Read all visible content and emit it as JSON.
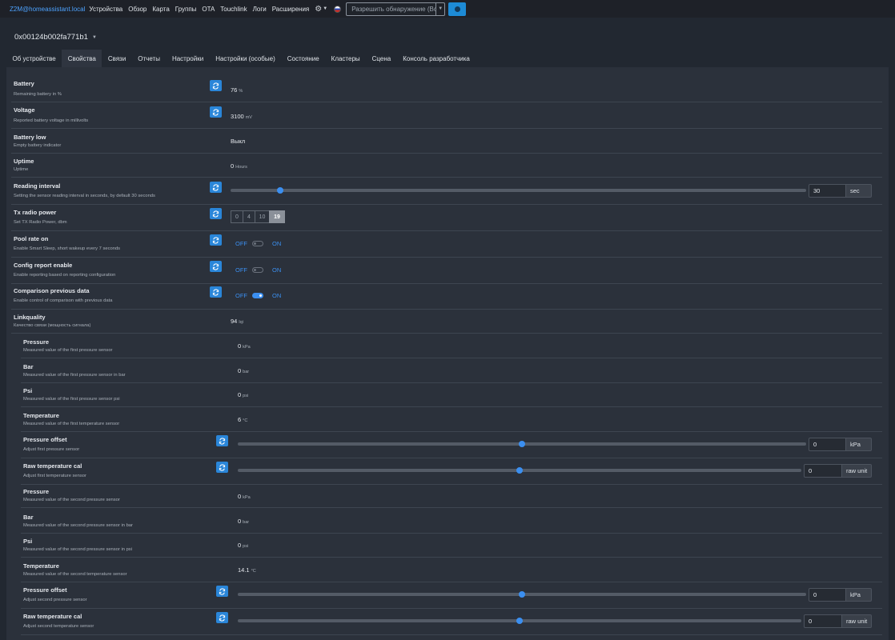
{
  "navbar": {
    "brand": "Z2M@homeassistant.local",
    "links": [
      "Устройства",
      "Обзор",
      "Карта",
      "Группы",
      "OTA",
      "Touchlink",
      "Логи",
      "Расширения"
    ],
    "permit_join_label": "Разрешить обнаружение (Все)"
  },
  "device": {
    "title": "0x00124b002fa771b1"
  },
  "tabs": [
    "Об устройстве",
    "Свойства",
    "Связи",
    "Отчеты",
    "Настройки",
    "Настройки (особые)",
    "Состояние",
    "Кластеры",
    "Сцена",
    "Консоль разработчика"
  ],
  "active_tab": "Свойства",
  "colors": {
    "accent": "#2a86d9",
    "toggle_on": "#3b8ff0",
    "background": "#222831",
    "panel": "#2b313b"
  },
  "properties": {
    "battery": {
      "label": "Battery",
      "desc": "Remaining battery in %",
      "value": "76",
      "unit": "%"
    },
    "voltage": {
      "label": "Voltage",
      "desc": "Reported battery voltage in millivolts",
      "value": "3100",
      "unit": "mV"
    },
    "battery_low": {
      "label": "Battery low",
      "desc": "Empty battery indicator",
      "value": "Выкл"
    },
    "uptime": {
      "label": "Uptime",
      "desc": "Uptime",
      "value": "0",
      "unit": "Hours"
    },
    "reading_interval": {
      "label": "Reading interval",
      "desc": "Setting the sensor reading interval in seconds, by default 30 seconds",
      "value": "30",
      "unit": "sec",
      "slider_fraction": 0.085
    },
    "tx_radio_power": {
      "label": "Tx radio power",
      "desc": "Set TX Radio Power, dbm",
      "options": [
        "0",
        "4",
        "10",
        "19"
      ],
      "selected": "19"
    },
    "pool_rate_on": {
      "label": "Pool rate on",
      "desc": "Enable Smart Sleep, short wakeup every 7 seconds",
      "off": "OFF",
      "on": "ON",
      "state": false
    },
    "config_report": {
      "label": "Config report enable",
      "desc": "Enable reporting based on reporting configuration",
      "off": "OFF",
      "on": "ON",
      "state": false
    },
    "comparison": {
      "label": "Comparison previous data",
      "desc": "Enable control of comparison with previous data",
      "off": "OFF",
      "on": "ON",
      "state": true
    },
    "linkquality": {
      "label": "Linkquality",
      "desc": "Качество связи (мощность сигнала)",
      "value": "94",
      "unit": "lqi"
    },
    "pressure1": {
      "label": "Pressure",
      "desc": "Measured value of the first pressure sensor",
      "value": "0",
      "unit": "kPa"
    },
    "bar1": {
      "label": "Bar",
      "desc": "Measured value of the first pressure sensor in bar",
      "value": "0",
      "unit": "bar"
    },
    "psi1": {
      "label": "Psi",
      "desc": "Measured value of the first pressure sensor psi",
      "value": "0",
      "unit": "psi"
    },
    "temperature1": {
      "label": "Temperature",
      "desc": "Measured value of the first temperature sensor",
      "value": "6",
      "unit": "°C"
    },
    "pressure_offset1": {
      "label": "Pressure offset",
      "desc": "Adjust first pressure sensor",
      "value": "0",
      "unit": "kPa",
      "slider_fraction": 0.5
    },
    "raw_temp_cal1": {
      "label": "Raw temperature cal",
      "desc": "Adjust first temperature sensor",
      "value": "0",
      "unit": "raw unit",
      "slider_fraction": 0.5
    },
    "pressure2": {
      "label": "Pressure",
      "desc": "Measured value of the second pressure sensor",
      "value": "0",
      "unit": "kPa"
    },
    "bar2": {
      "label": "Bar",
      "desc": "Measured value of the second pressure sensor in bar",
      "value": "0",
      "unit": "bar"
    },
    "psi2": {
      "label": "Psi",
      "desc": "Measured value of the second pressure sensor in psi",
      "value": "0",
      "unit": "psi"
    },
    "temperature2": {
      "label": "Temperature",
      "desc": "Measured value of the second temperature sensor",
      "value": "14.1",
      "unit": "°C"
    },
    "pressure_offset2": {
      "label": "Pressure offset",
      "desc": "Adjust second pressure sensor",
      "value": "0",
      "unit": "kPa",
      "slider_fraction": 0.5
    },
    "raw_temp_cal2": {
      "label": "Raw temperature cal",
      "desc": "Adjust second temperature sensor",
      "value": "0",
      "unit": "raw unit",
      "slider_fraction": 0.5
    }
  }
}
